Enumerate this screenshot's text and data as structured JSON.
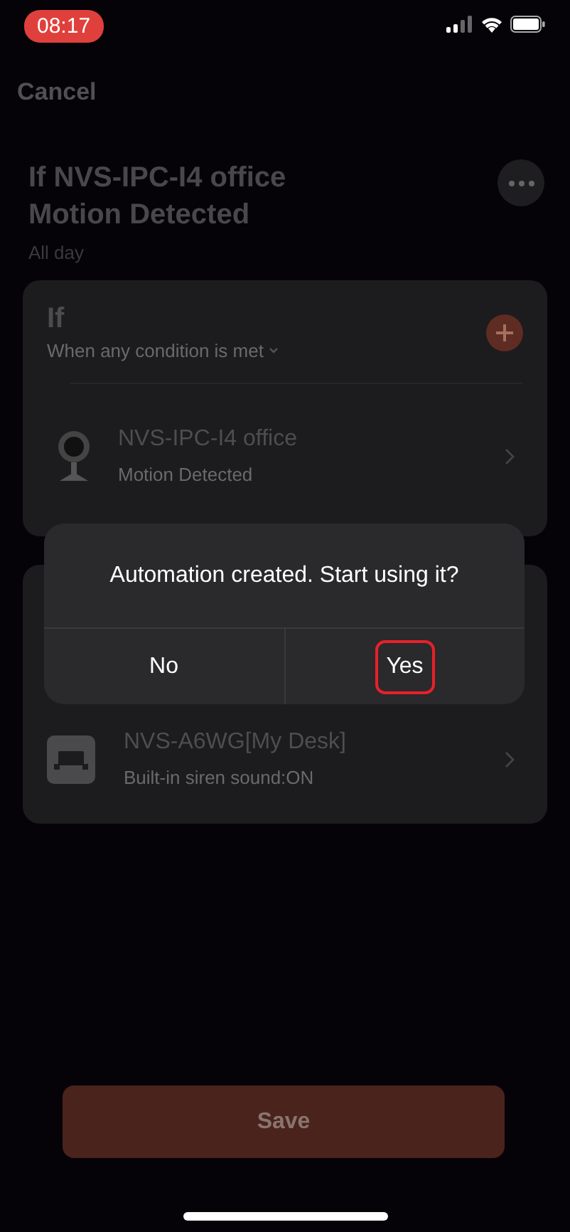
{
  "status_bar": {
    "time": "08:17"
  },
  "nav": {
    "cancel": "Cancel"
  },
  "header": {
    "title_lines": [
      "If NVS-IPC-I4 office",
      "Motion Detected"
    ],
    "subtitle": "All day"
  },
  "if_card": {
    "title": "If",
    "condition": "When any condition is met",
    "items": [
      {
        "kind": "camera",
        "name": "NVS-IPC-I4 office",
        "detail": "Motion Detected"
      }
    ]
  },
  "then_card": {
    "items": [
      {
        "kind": "siren",
        "name": "NVS-A6WG[My Desk]",
        "detail": "Built-in siren sound:ON"
      }
    ]
  },
  "dialog": {
    "message": "Automation created. Start using it?",
    "buttons": [
      {
        "label": "No",
        "highlighted": false
      },
      {
        "label": "Yes",
        "highlighted": true
      }
    ]
  },
  "save_button": {
    "label": "Save"
  }
}
